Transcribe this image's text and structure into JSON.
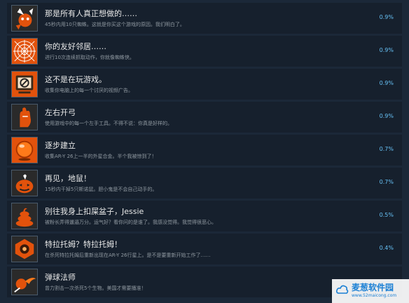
{
  "achievements": [
    {
      "icon": "bomb-mascot-icon",
      "title": "那是所有人真正想做的……",
      "desc": "45秒内用10只蜘蛛。这就是你买这个游戏的原因。我们明白了。",
      "pct": "0.9%"
    },
    {
      "icon": "spider-web-icon",
      "title": "你的友好邻居……",
      "desc": "进行10次连续抓取动作，你就像蜘蛛侠。",
      "pct": "0.9%"
    },
    {
      "icon": "no-screen-icon",
      "title": "这不是在玩游戏。",
      "desc": "收集你电脑上的每一个讨厌的视频广告。",
      "pct": "0.9%"
    },
    {
      "icon": "left-hand-icon",
      "title": "左右开弓",
      "desc": "使用游戏中的每一个左手工具。不得不说：你真是好样的。",
      "pct": "0.9%"
    },
    {
      "icon": "orange-orb-icon",
      "title": "逐步建立",
      "desc": "收集AR-Y 26上一半的外星合金。半个我被惊到了！",
      "pct": "0.7%"
    },
    {
      "icon": "pumpkin-icon",
      "title": "再见，地鼠！",
      "desc": "15秒内干掉5只斯诺鼠。胆小鬼是不会自己动手的。",
      "pct": "0.7%"
    },
    {
      "icon": "poop-icon",
      "title": "别往我身上扣屎盆子，Jessie",
      "desc": "被粉长弄得邋遢万分。运气好？看你问的是谁了。我感没觉得。我觉得很恶心。",
      "pct": "0.5%"
    },
    {
      "icon": "burnt-badge-icon",
      "title": "特拉托姆？特拉托姆！",
      "desc": "在杀死特拉托姆后重新出现在AR-Y 26行星上。是不是要重新开始工作了……",
      "pct": "0.4%"
    },
    {
      "icon": "fireball-icon",
      "title": "弹球法师",
      "desc": "曾力割击一次杀死5个生物。美国才需要播准！",
      "pct": ""
    }
  ],
  "watermark": {
    "name": "麦葱软件园",
    "url": "www.52maicong.com"
  }
}
